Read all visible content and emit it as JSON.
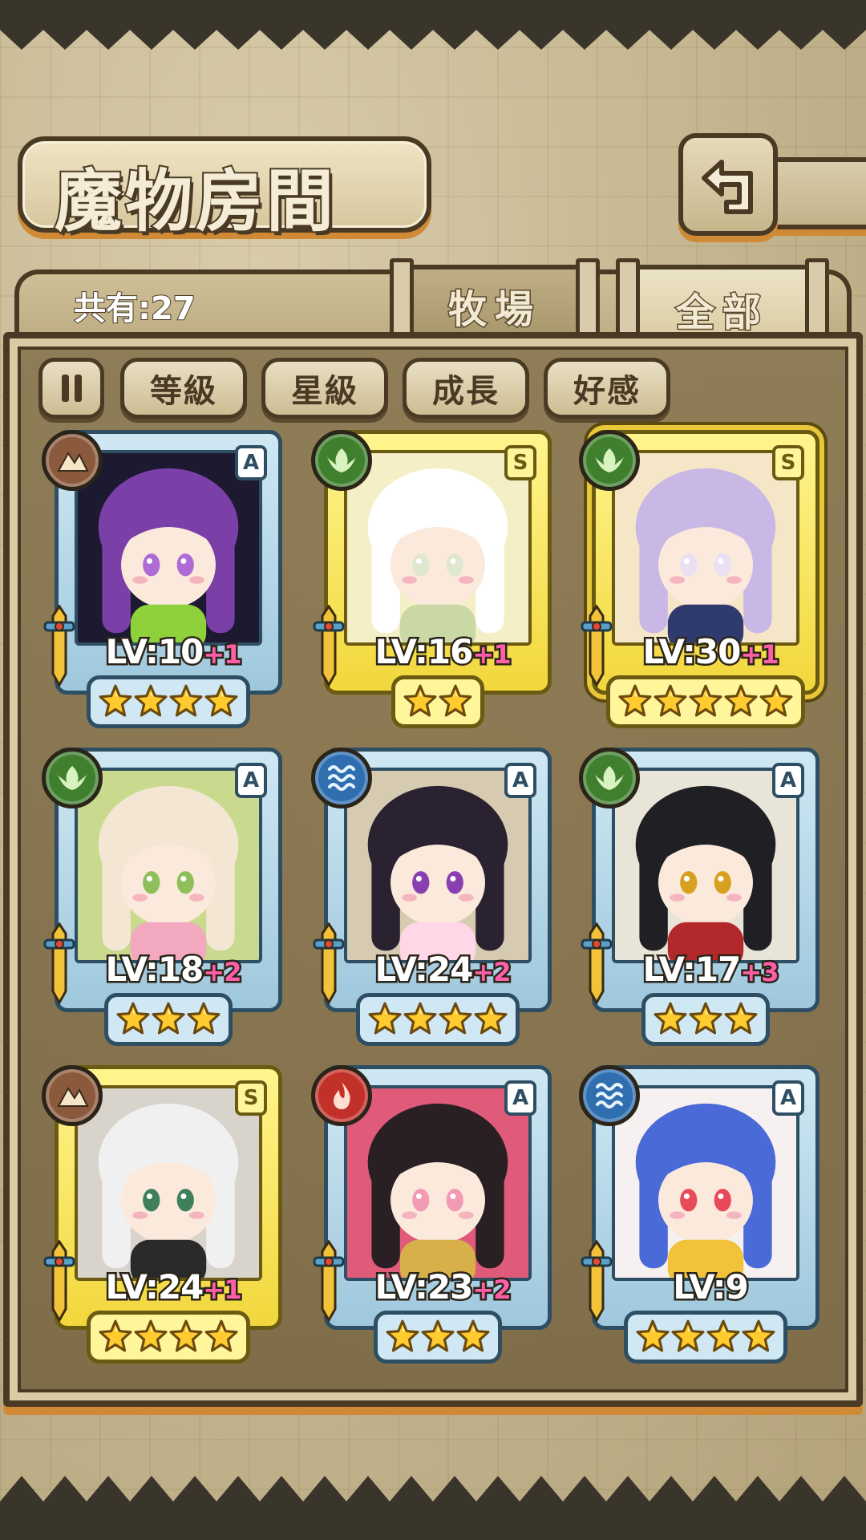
{
  "header": {
    "title": "魔物房間"
  },
  "back_button": {
    "icon": "back-arrow-icon"
  },
  "tabs": {
    "count_label": "共有:27",
    "ranch": "牧場",
    "all": "全部",
    "active": "all"
  },
  "filters": {
    "sort_icon": "sort-toggle-icon",
    "level": "等級",
    "star": "星級",
    "growth": "成長",
    "affection": "好感"
  },
  "colors": {
    "accent_orange": "#d08a35",
    "outline_brown": "#4a3a24",
    "rank_a_frame": "#9fc8dd",
    "rank_s_frame": "#f2d73c",
    "level_plus": "#ff5fa8"
  },
  "monsters": [
    {
      "element": "earth",
      "rank": "A",
      "level": "LV:10",
      "plus": "+1",
      "stars": 4,
      "palette": [
        "#1c1930",
        "#7b3fa8",
        "#b06ad6",
        "#8fd13a"
      ]
    },
    {
      "element": "wood",
      "rank": "S",
      "level": "LV:16",
      "plus": "+1",
      "stars": 2,
      "palette": [
        "#f4efc7",
        "#ffffff",
        "#dfe7cf",
        "#c9d8a5"
      ]
    },
    {
      "element": "wood",
      "rank": "S",
      "level": "LV:30",
      "plus": "+1",
      "stars": 5,
      "palette": [
        "#f6e6c8",
        "#c9b8e6",
        "#e9e0f4",
        "#2f3b6e"
      ],
      "ornate": true
    },
    {
      "element": "wood",
      "rank": "A",
      "level": "LV:18",
      "plus": "+2",
      "stars": 3,
      "palette": [
        "#c9d98e",
        "#f3e6d3",
        "#8fbf5a",
        "#f2a9c0"
      ]
    },
    {
      "element": "water",
      "rank": "A",
      "level": "LV:24",
      "plus": "+2",
      "stars": 4,
      "palette": [
        "#d6cbb0",
        "#2a2230",
        "#8a3fb0",
        "#ffd7e6"
      ]
    },
    {
      "element": "wood",
      "rank": "A",
      "level": "LV:17",
      "plus": "+3",
      "stars": 3,
      "palette": [
        "#e9e4d8",
        "#202024",
        "#d8a020",
        "#b3282a"
      ]
    },
    {
      "element": "earth",
      "rank": "S",
      "level": "LV:24",
      "plus": "+1",
      "stars": 4,
      "palette": [
        "#d8d4cc",
        "#f0f0f0",
        "#3f7f5a",
        "#2a2a2a"
      ]
    },
    {
      "element": "fire",
      "rank": "A",
      "level": "LV:23",
      "plus": "+2",
      "stars": 3,
      "palette": [
        "#e05a7a",
        "#2a2024",
        "#f29ab3",
        "#d8b04a"
      ]
    },
    {
      "element": "water",
      "rank": "A",
      "level": "LV:9",
      "plus": "",
      "stars": 4,
      "palette": [
        "#f6f0f0",
        "#4a6ad8",
        "#e84a5a",
        "#f2c23a"
      ]
    }
  ]
}
